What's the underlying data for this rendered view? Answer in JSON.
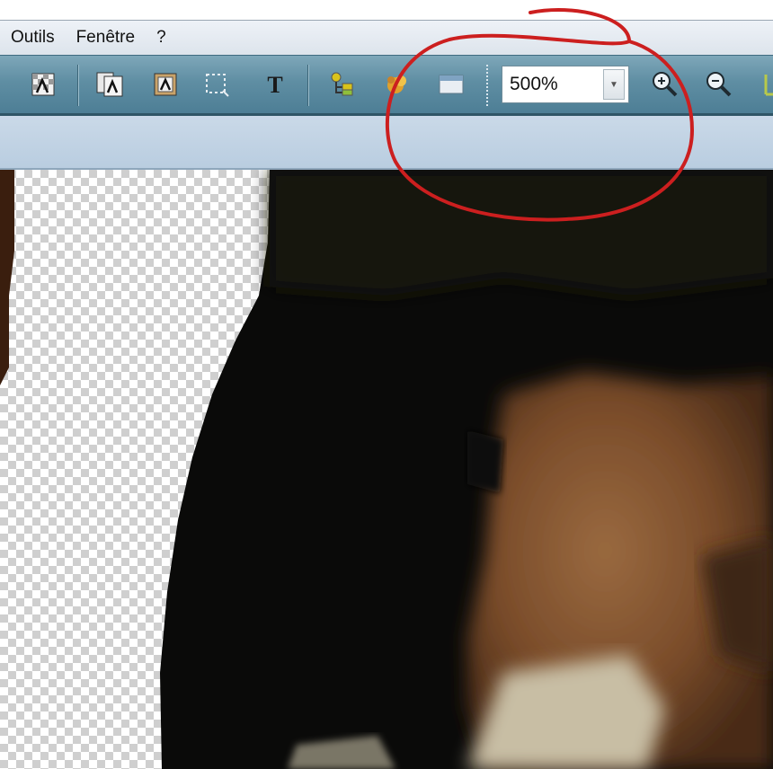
{
  "menu": {
    "items": [
      {
        "label": "Outils"
      },
      {
        "label": "Fenêtre"
      },
      {
        "label": "?"
      }
    ]
  },
  "toolbar": {
    "buttons": [
      {
        "icon": "transparency-icon"
      },
      {
        "icon": "copy-image-icon"
      },
      {
        "icon": "image-properties-icon"
      },
      {
        "icon": "selection-icon"
      },
      {
        "icon": "text-icon"
      },
      {
        "icon": "layers-icon"
      },
      {
        "icon": "effects-icon"
      },
      {
        "icon": "window-icon"
      },
      {
        "icon": "zoom-in-icon"
      },
      {
        "icon": "zoom-out-icon"
      },
      {
        "icon": "fit-icon"
      }
    ],
    "zoom": {
      "value": "500%"
    }
  },
  "colors": {
    "toolbar": "#5f8ea3",
    "band": "#c0d2e4",
    "annotation": "#cc1f1f",
    "dark_fur": "#0b0a08",
    "brown_fur": "#8a5a34"
  },
  "canvas": {
    "content": "zoomed photo with transparent checkerboard area"
  }
}
